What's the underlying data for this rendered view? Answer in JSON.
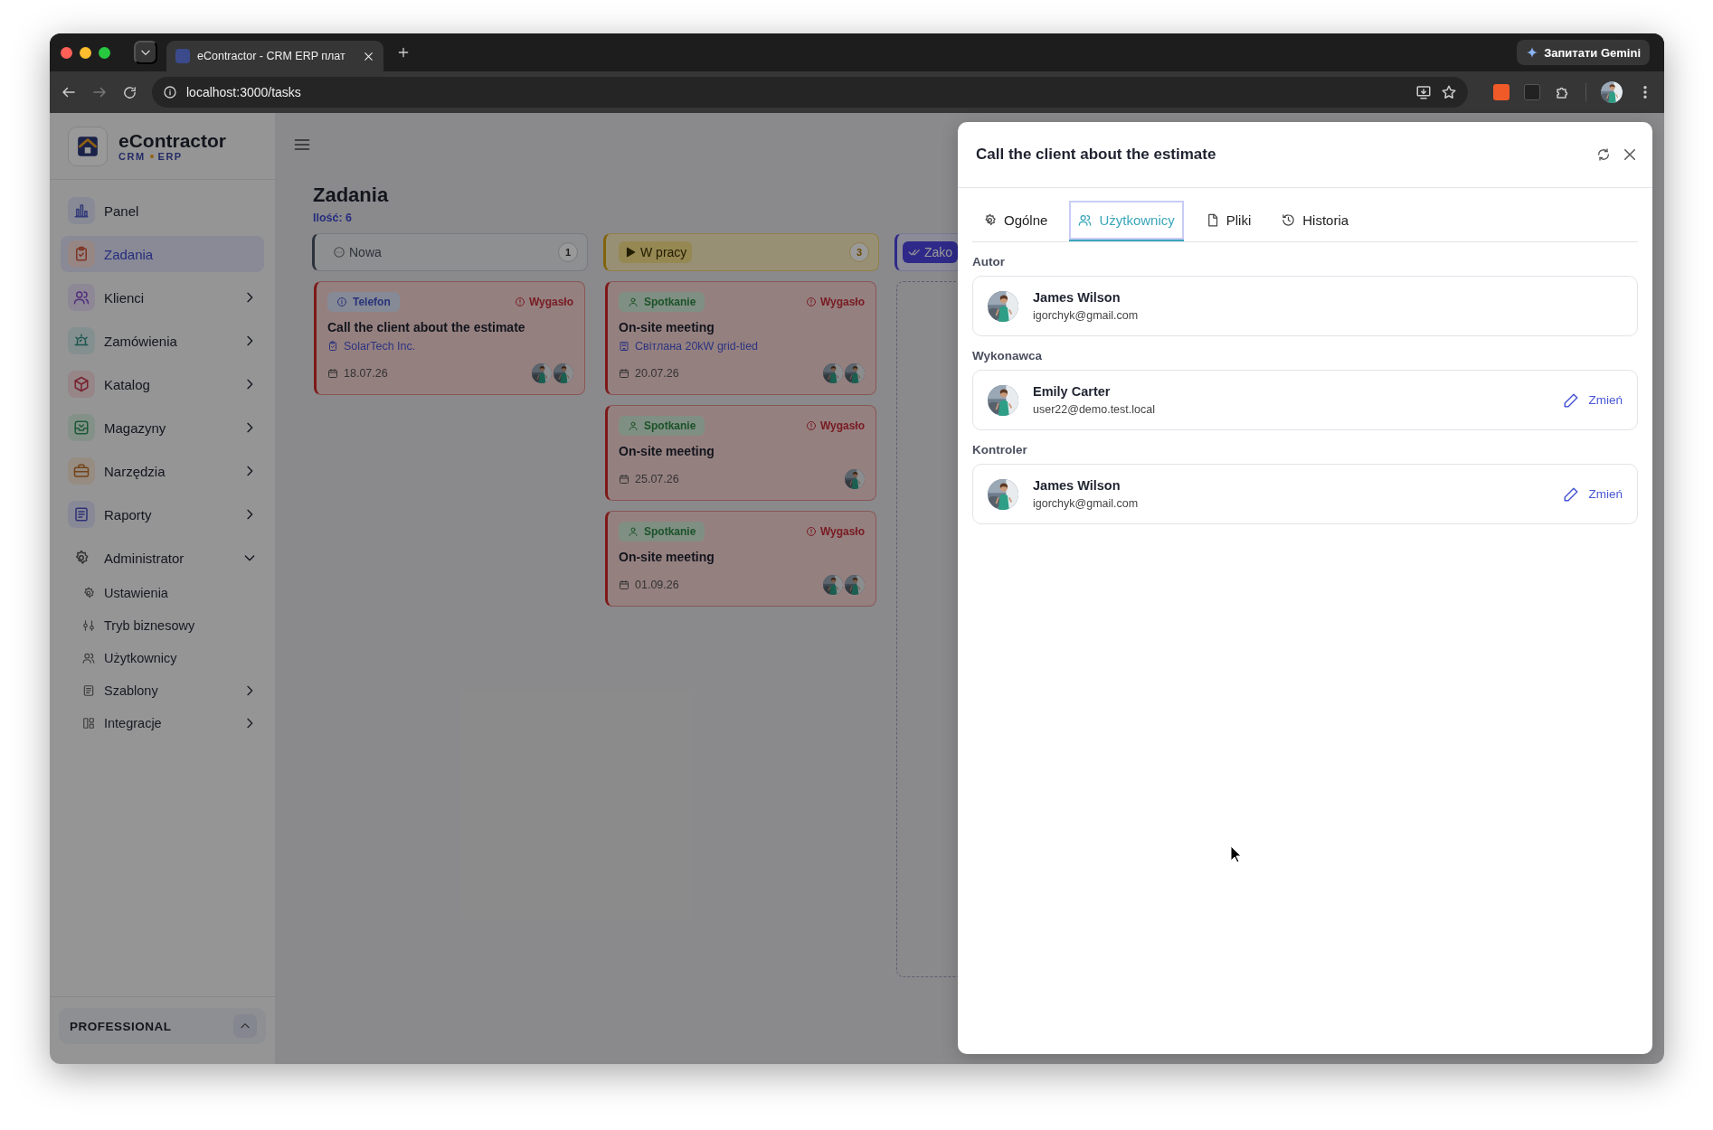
{
  "browser": {
    "tab_title": "eContractor - CRM ERP плат",
    "url": "localhost:3000/tasks",
    "gemini_button": "Запитати Gemini"
  },
  "sidebar": {
    "brand": "eContractor",
    "tagline": [
      "CRM",
      "ERP"
    ],
    "items": [
      {
        "label": "Panel",
        "selected": false
      },
      {
        "label": "Zadania",
        "selected": true
      },
      {
        "label": "Klienci",
        "selected": false,
        "has_submenu": true
      },
      {
        "label": "Zamówienia",
        "selected": false,
        "has_submenu": true
      },
      {
        "label": "Katalog",
        "selected": false,
        "has_submenu": true
      },
      {
        "label": "Magazyny",
        "selected": false,
        "has_submenu": true
      },
      {
        "label": "Narzędzia",
        "selected": false,
        "has_submenu": true
      },
      {
        "label": "Raporty",
        "selected": false,
        "has_submenu": true
      },
      {
        "label": "Administrator",
        "selected": false,
        "has_submenu": true,
        "expanded": true,
        "children": [
          {
            "label": "Ustawienia",
            "selected": false
          },
          {
            "label": "Tryb biznesowy",
            "selected": false
          },
          {
            "label": "Użytkownicy",
            "selected": false
          },
          {
            "label": "Szablony",
            "selected": false,
            "has_submenu": true
          },
          {
            "label": "Integracje",
            "selected": false,
            "has_submenu": true
          }
        ]
      }
    ],
    "plan": "PROFESSIONAL"
  },
  "board": {
    "title": "Zadania",
    "count": "Ilość: 6",
    "columns": [
      {
        "kind": "new",
        "title": "Nowa",
        "count": "1",
        "cards": [
          {
            "type": {
              "kind": "phone",
              "label": "Telefon"
            },
            "overdue": true,
            "status": "Wygasło",
            "title": "Call the client about the estimate",
            "link": {
              "kind": "client",
              "label": "SolarTech Inc."
            },
            "date": "18.07.26"
          }
        ]
      },
      {
        "kind": "in_progress",
        "title": "W pracy",
        "count": "3",
        "cards": [
          {
            "type": {
              "kind": "meeting",
              "label": "Spotkanie"
            },
            "overdue": true,
            "status": "Wygasło",
            "title": "On-site meeting",
            "link": {
              "kind": "order",
              "label": "Світлана 20kW grid-tied"
            },
            "date": "20.07.26"
          },
          {
            "type": {
              "kind": "meeting",
              "label": "Spotkanie"
            },
            "overdue": true,
            "status": "Wygasło",
            "title": "On-site meeting",
            "date": "25.07.26"
          },
          {
            "type": {
              "kind": "meeting",
              "label": "Spotkanie"
            },
            "overdue": true,
            "status": "Wygasło",
            "title": "On-site meeting",
            "date": "01.09.26"
          }
        ]
      },
      {
        "kind": "done",
        "title": "Zako"
      }
    ]
  },
  "panel": {
    "title": "Call the client about the estimate",
    "tabs": [
      {
        "kind": "general",
        "label": "Ogólne",
        "selected": false
      },
      {
        "kind": "users",
        "label": "Użytkownicy",
        "selected": true
      },
      {
        "kind": "files",
        "label": "Pliki",
        "selected": false
      },
      {
        "kind": "history",
        "label": "Historia",
        "selected": false
      }
    ],
    "roles": [
      {
        "label": "Autor",
        "name": "James Wilson",
        "email": "igorchyk@gmail.com"
      },
      {
        "label": "Wykonawca",
        "name": "Emily Carter",
        "email": "user22@demo.test.local",
        "action": "Zmień"
      },
      {
        "label": "Kontroler",
        "name": "James Wilson",
        "email": "igorchyk@gmail.com",
        "action": "Zmień"
      }
    ]
  }
}
